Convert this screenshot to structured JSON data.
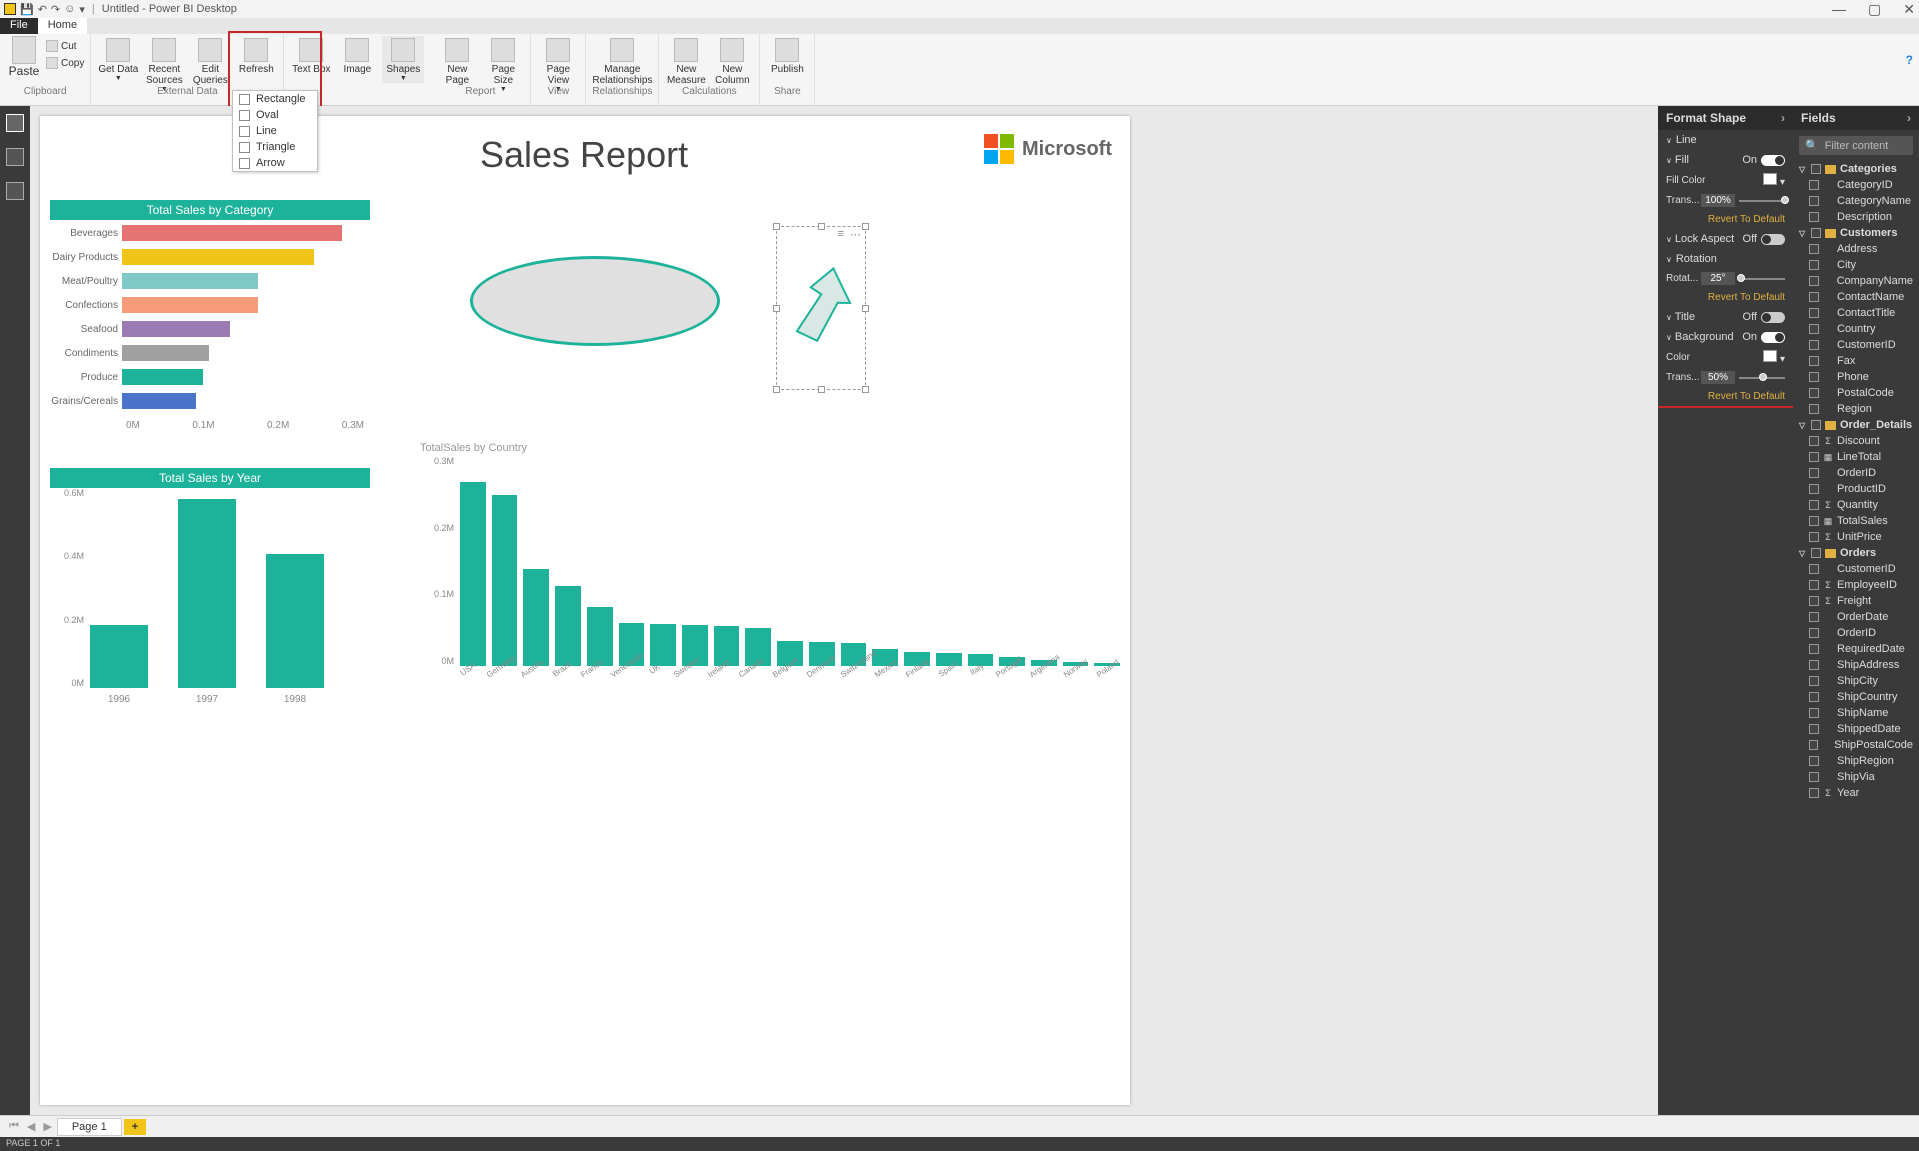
{
  "title": "Untitled - Power BI Desktop",
  "window": {
    "min": "—",
    "max": "▢",
    "close": "✕"
  },
  "menu_tabs": {
    "file": "File",
    "home": "Home"
  },
  "ribbon": {
    "clipboard": {
      "label": "Clipboard",
      "paste": "Paste",
      "cut": "Cut",
      "copy": "Copy"
    },
    "external": {
      "label": "External Data",
      "get": "Get Data",
      "recent": "Recent Sources",
      "edit": "Edit Queries",
      "refresh": "Refresh"
    },
    "insert": {
      "text": "Text Box",
      "image": "Image",
      "shapes": "Shapes"
    },
    "report_grp": {
      "label": "Report",
      "newpage": "New Page",
      "pagesize": "Page Size"
    },
    "view_grp": {
      "label": "View",
      "pageview": "Page View"
    },
    "rel": {
      "label": "Relationships",
      "manage": "Manage Relationships"
    },
    "calc": {
      "label": "Calculations",
      "measure": "New Measure",
      "column": "New Column"
    },
    "share": {
      "label": "Share",
      "publish": "Publish"
    }
  },
  "shapes_dd": [
    "Rectangle",
    "Oval",
    "Line",
    "Triangle",
    "Arrow"
  ],
  "report": {
    "title": "Sales Report",
    "ms": "Microsoft"
  },
  "chart_data": [
    {
      "type": "bar",
      "orientation": "horizontal",
      "title": "Total Sales by Category",
      "categories": [
        "Beverages",
        "Dairy Products",
        "Meat/Poultry",
        "Confections",
        "Seafood",
        "Condiments",
        "Produce",
        "Grains/Cereals"
      ],
      "values": [
        0.287,
        0.251,
        0.178,
        0.177,
        0.141,
        0.113,
        0.105,
        0.096
      ],
      "colors": [
        "#e57373",
        "#f0c419",
        "#7ec8c8",
        "#f59b7a",
        "#9c7bb5",
        "#a0a0a0",
        "#1db39a",
        "#4a74c9"
      ],
      "xticks": [
        "0M",
        "0.1M",
        "0.2M",
        "0.3M"
      ],
      "xlim": [
        0,
        0.3
      ]
    },
    {
      "type": "bar",
      "title": "Total Sales by Year",
      "categories": [
        "1996",
        "1997",
        "1998"
      ],
      "values": [
        0.22,
        0.66,
        0.47
      ],
      "yticks": [
        "0M",
        "0.2M",
        "0.4M",
        "0.6M"
      ],
      "ylim": [
        0,
        0.7
      ],
      "color": "#1db39a"
    },
    {
      "type": "bar",
      "title": "TotalSales by Country",
      "categories": [
        "USA",
        "Germany",
        "Austria",
        "Brazil",
        "France",
        "Venezuela",
        "UK",
        "Sweden",
        "Ireland",
        "Canada",
        "Belgium",
        "Denmark",
        "Switzerland",
        "Mexico",
        "Finland",
        "Spain",
        "Italy",
        "Portugal",
        "Argentina",
        "Norway",
        "Poland"
      ],
      "values": [
        0.263,
        0.245,
        0.139,
        0.115,
        0.085,
        0.061,
        0.06,
        0.059,
        0.057,
        0.055,
        0.036,
        0.035,
        0.033,
        0.025,
        0.02,
        0.019,
        0.017,
        0.013,
        0.009,
        0.006,
        0.004
      ],
      "yticks": [
        "0M",
        "0.1M",
        "0.2M",
        "0.3M"
      ],
      "ylim": [
        0,
        0.3
      ],
      "color": "#1db39a"
    }
  ],
  "format_shape": {
    "title": "Format Shape",
    "line": "Line",
    "fill": "Fill",
    "fill_on": "On",
    "fill_color": "Fill Color",
    "trans": "Trans...",
    "trans_val": "100%",
    "revert": "Revert To Default",
    "lock": "Lock Aspect",
    "lock_off": "Off",
    "rotation": "Rotation",
    "rotat": "Rotat...",
    "rotat_val": "25°",
    "title_sec": "Title",
    "title_off": "Off",
    "bg": "Background",
    "bg_on": "On",
    "color": "Color",
    "bg_trans_val": "50%"
  },
  "fields": {
    "title": "Fields",
    "filter": "Filter content",
    "tables": [
      {
        "name": "Categories",
        "fields": [
          "CategoryID",
          "CategoryName",
          "Description"
        ]
      },
      {
        "name": "Customers",
        "fields": [
          "Address",
          "City",
          "CompanyName",
          "ContactName",
          "ContactTitle",
          "Country",
          "CustomerID",
          "Fax",
          "Phone",
          "PostalCode",
          "Region"
        ]
      },
      {
        "name": "Order_Details",
        "fields": [
          "Discount",
          "LineTotal",
          "OrderID",
          "ProductID",
          "Quantity",
          "TotalSales",
          "UnitPrice"
        ]
      },
      {
        "name": "Orders",
        "fields": [
          "CustomerID",
          "EmployeeID",
          "Freight",
          "OrderDate",
          "OrderID",
          "RequiredDate",
          "ShipAddress",
          "ShipCity",
          "ShipCountry",
          "ShipName",
          "ShippedDate",
          "ShipPostalCode",
          "ShipRegion",
          "ShipVia",
          "Year"
        ]
      }
    ],
    "sigma_fields": [
      "Discount",
      "LineTotal",
      "Quantity",
      "TotalSales",
      "UnitPrice",
      "EmployeeID",
      "Freight",
      "Year"
    ],
    "calc_fields": [
      "LineTotal",
      "TotalSales"
    ]
  },
  "page": {
    "label": "Page 1",
    "plus": "+"
  },
  "status": "PAGE 1 OF 1"
}
